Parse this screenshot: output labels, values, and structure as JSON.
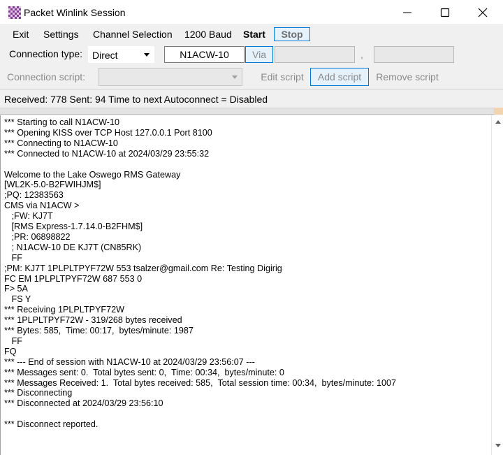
{
  "window": {
    "title": "Packet Winlink Session"
  },
  "menu": {
    "exit": "Exit",
    "settings": "Settings",
    "channel_selection": "Channel Selection",
    "baud": "1200 Baud",
    "start": "Start",
    "stop": "Stop"
  },
  "connection": {
    "type_label": "Connection type:",
    "type_value": "Direct",
    "callsign": "N1ACW-10",
    "via_label": "Via",
    "via_separator": ","
  },
  "script": {
    "label": "Connection script:",
    "edit": "Edit script",
    "add": "Add script",
    "remove": "Remove script"
  },
  "status": {
    "text": "Received: 778  Sent: 94  Time to next Autoconnect = Disabled"
  },
  "log": [
    "*** Starting to call N1ACW-10",
    "*** Opening KISS over TCP Host 127.0.0.1 Port 8100",
    "*** Connecting to N1ACW-10",
    "*** Connected to N1ACW-10 at 2024/03/29 23:55:32",
    "",
    "Welcome to the Lake Oswego RMS Gateway",
    "[WL2K-5.0-B2FWIHJM$]",
    ";PQ: 12383563",
    "CMS via N1ACW >",
    "   ;FW: KJ7T",
    "   [RMS Express-1.7.14.0-B2FHM$]",
    "   ;PR: 06898822",
    "   ; N1ACW-10 DE KJ7T (CN85RK)",
    "   FF",
    ";PM: KJ7T 1PLPLTPYF72W 553 tsalzer@gmail.com Re: Testing Digirig",
    "FC EM 1PLPLTPYF72W 687 553 0",
    "F> 5A",
    "   FS Y",
    "*** Receiving 1PLPLTPYF72W",
    "*** 1PLPLTPYF72W - 319/268 bytes received",
    "*** Bytes: 585,  Time: 00:17,  bytes/minute: 1987",
    "   FF",
    "FQ",
    "*** --- End of session with N1ACW-10 at 2024/03/29 23:56:07 ---",
    "*** Messages sent: 0.  Total bytes sent: 0,  Time: 00:34,  bytes/minute: 0",
    "*** Messages Received: 1.  Total bytes received: 585,  Total session time: 00:34,  bytes/minute: 1007",
    "*** Disconnecting",
    "*** Disconnected at 2024/03/29 23:56:10",
    "",
    "*** Disconnect reported."
  ],
  "icons": {
    "app": "checkerboard-app-icon",
    "minimize": "minimize-icon",
    "maximize": "maximize-icon",
    "close": "close-icon"
  },
  "colors": {
    "accent": "#0078d7",
    "button_bg": "#e5f1fb",
    "app_icon": "#7b3f8c"
  }
}
